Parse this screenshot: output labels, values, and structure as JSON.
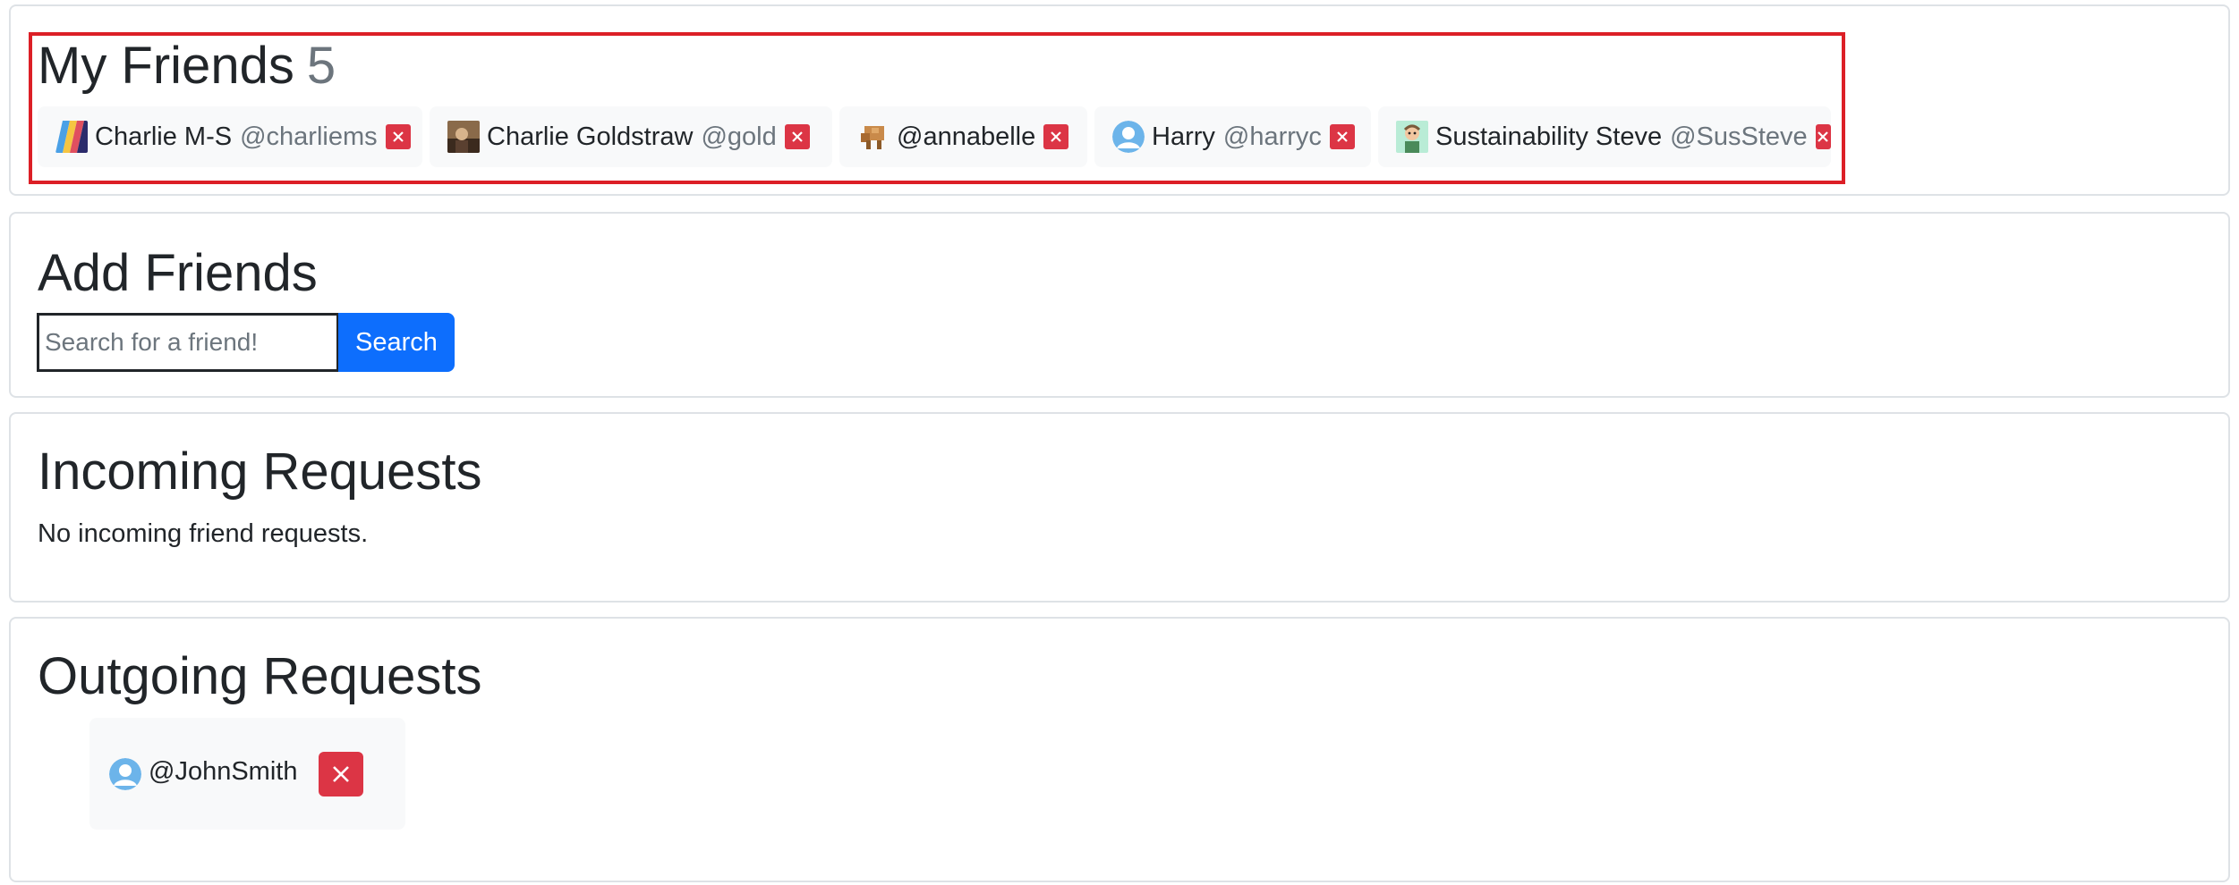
{
  "my_friends": {
    "title": "My Friends",
    "count": "5",
    "friends": [
      {
        "name": "Charlie M-S",
        "handle": "@charliems",
        "avatar": "stripes-avatar-icon"
      },
      {
        "name": "Charlie Goldstraw",
        "handle": "@gold",
        "avatar": "photo-avatar-icon"
      },
      {
        "name": "",
        "handle": "@annabelle",
        "avatar": "block-creature-avatar-icon"
      },
      {
        "name": "Harry",
        "handle": "@harryc",
        "avatar": "default-user-avatar-icon"
      },
      {
        "name": "Sustainability Steve",
        "handle": "@SusSteve",
        "avatar": "cartoon-avatar-icon"
      }
    ]
  },
  "add_friends": {
    "title": "Add Friends",
    "search_placeholder": "Search for a friend!",
    "search_button": "Search"
  },
  "incoming": {
    "title": "Incoming Requests",
    "empty_text": "No incoming friend requests."
  },
  "outgoing": {
    "title": "Outgoing Requests",
    "requests": [
      {
        "handle": "@JohnSmith",
        "avatar": "default-user-avatar-icon"
      }
    ]
  },
  "colors": {
    "accent": "#0d6efd",
    "danger": "#dc3545",
    "muted": "#6c757d",
    "highlight": "#dc1f26"
  }
}
